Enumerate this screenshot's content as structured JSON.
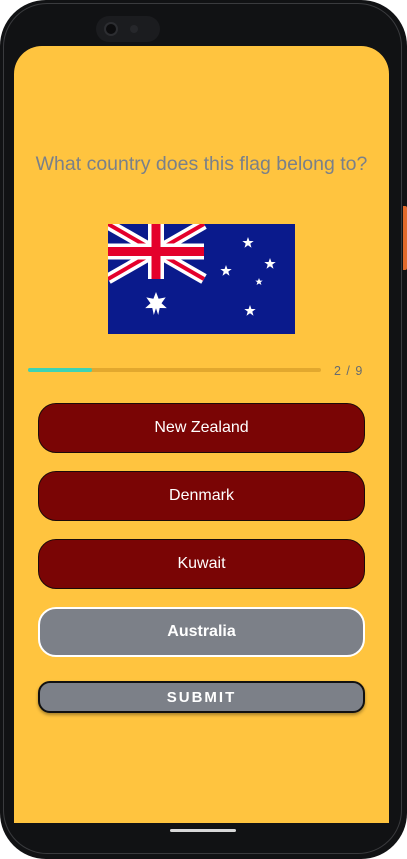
{
  "question": "What country does this flag belong to?",
  "flag": {
    "country": "Australia",
    "colors": {
      "blue": "#0A1A8C",
      "red": "#E4002B",
      "white": "#FFFFFF"
    }
  },
  "progress": {
    "current": 2,
    "total": 9,
    "label": "2 / 9",
    "fraction": 0.22
  },
  "options": [
    {
      "label": "New Zealand",
      "state": "incorrect"
    },
    {
      "label": "Denmark",
      "state": "incorrect"
    },
    {
      "label": "Kuwait",
      "state": "incorrect"
    },
    {
      "label": "Australia",
      "state": "selected"
    }
  ],
  "submit_label": "SUBMIT",
  "theme": {
    "background": "#FFC43F",
    "wrong_option": "#7A0505",
    "selected_option": "#7C8088",
    "progress_fill": "#3DD3B4"
  }
}
